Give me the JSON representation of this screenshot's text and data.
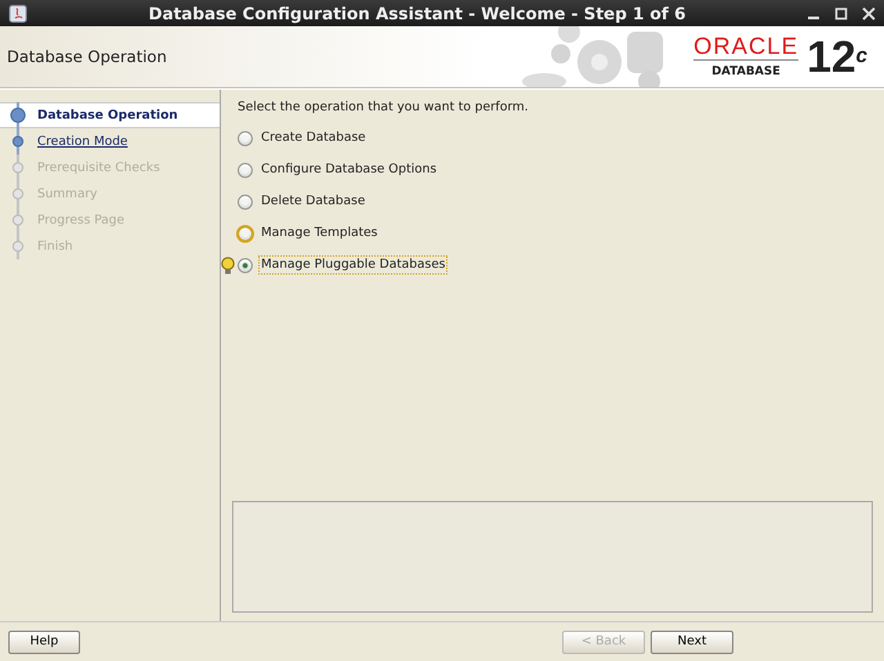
{
  "window": {
    "title": "Database Configuration Assistant - Welcome - Step 1 of 6"
  },
  "header": {
    "title": "Database Operation",
    "logo": {
      "brand": "ORACLE",
      "product": "DATABASE",
      "version": "12$^{c}$"
    }
  },
  "steps": [
    {
      "label": "Database Operation",
      "selected": true,
      "enabled": true
    },
    {
      "label": "Creation Mode",
      "selected": false,
      "enabled": true
    },
    {
      "label": "Prerequisite Checks",
      "selected": false,
      "enabled": false
    },
    {
      "label": "Summary",
      "selected": false,
      "enabled": false
    },
    {
      "label": "Progress Page",
      "selected": false,
      "enabled": false
    },
    {
      "label": "Finish",
      "selected": false,
      "enabled": false
    }
  ],
  "prompt": "Select the operation that you want to perform.",
  "operations": [
    {
      "label": "Create Database",
      "selected": false,
      "hovered": false
    },
    {
      "label": "Configure Database Options",
      "selected": false,
      "hovered": false
    },
    {
      "label": "Delete Database",
      "selected": false,
      "hovered": false
    },
    {
      "label": "Manage Templates",
      "selected": false,
      "hovered": true
    },
    {
      "label": "Manage Pluggable Databases",
      "selected": true,
      "hovered": false
    }
  ],
  "left_buttons": [
    {
      "label": "Help",
      "disabled": false
    }
  ],
  "right_buttons": [
    {
      "label": "< Back",
      "disabled": true
    },
    {
      "label": "Next",
      "disabled": false
    }
  ]
}
